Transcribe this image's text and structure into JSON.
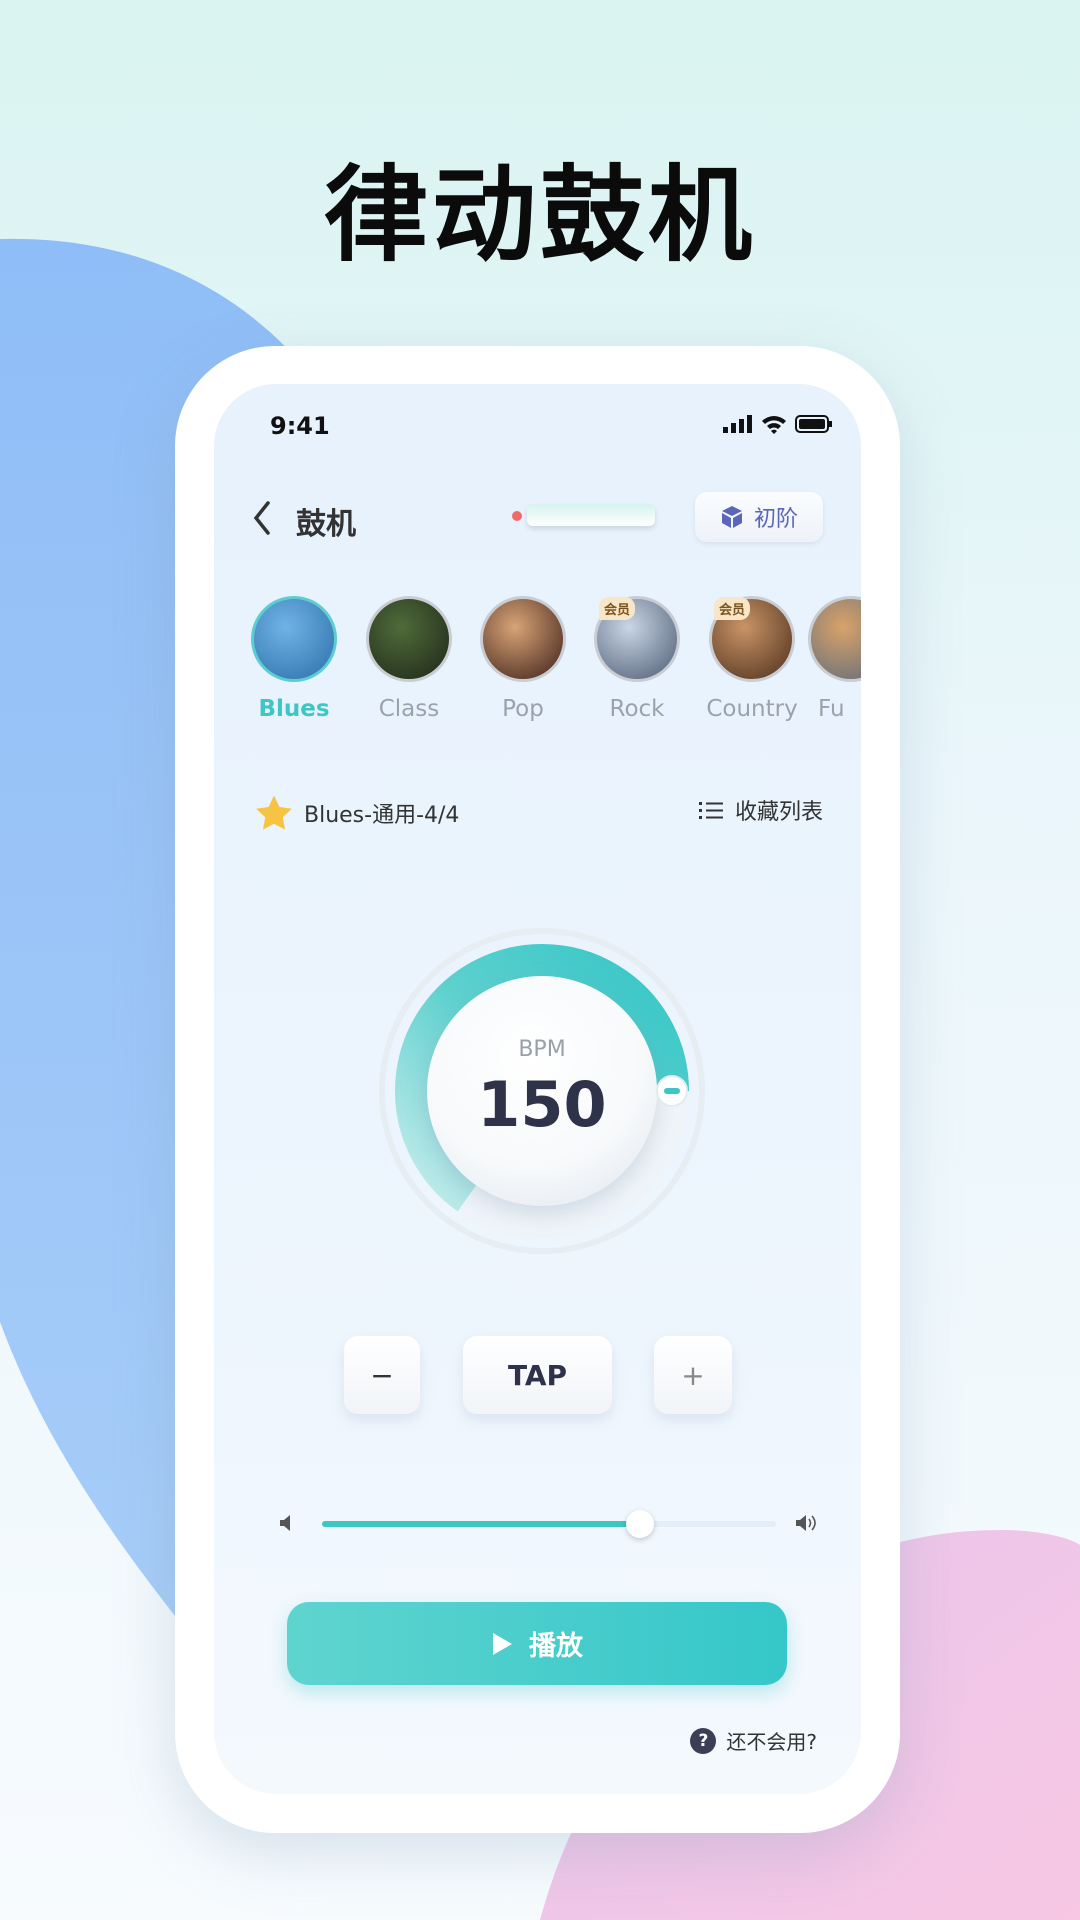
{
  "promo_title": "律动鼓机",
  "status_bar": {
    "time": "9:41"
  },
  "header": {
    "back_icon": "chevron-left-icon",
    "title": "鼓机",
    "level_badge": "初阶"
  },
  "genres": [
    {
      "label": "Blues",
      "active": true,
      "vip": "",
      "colors": [
        "#6fb3e6",
        "#2b6fa8"
      ]
    },
    {
      "label": "Class",
      "active": false,
      "vip": "",
      "colors": [
        "#4f6b3a",
        "#1e2618"
      ]
    },
    {
      "label": "Pop",
      "active": false,
      "vip": "",
      "colors": [
        "#d8a477",
        "#3c1e18"
      ]
    },
    {
      "label": "Rock",
      "active": false,
      "vip": "会员",
      "colors": [
        "#c9d6e6",
        "#4c5a72"
      ]
    },
    {
      "label": "Country",
      "active": false,
      "vip": "会员",
      "colors": [
        "#c99466",
        "#4c2e1c"
      ]
    },
    {
      "label": "Fu",
      "active": false,
      "vip": "",
      "colors": [
        "#d9a26a",
        "#5a6a7a"
      ]
    }
  ],
  "favorite": {
    "current": "Blues-通用-4/4",
    "list_label": "收藏列表"
  },
  "tempo": {
    "label": "BPM",
    "value": "150",
    "dial_fraction": 0.62
  },
  "controls": {
    "minus": "−",
    "tap": "TAP",
    "plus": "+"
  },
  "volume": {
    "level": 0.7
  },
  "play_label": "播放",
  "help_label": "还不会用?",
  "colors": {
    "accent": "#3cc6c6",
    "badge": "#5b66b8"
  }
}
